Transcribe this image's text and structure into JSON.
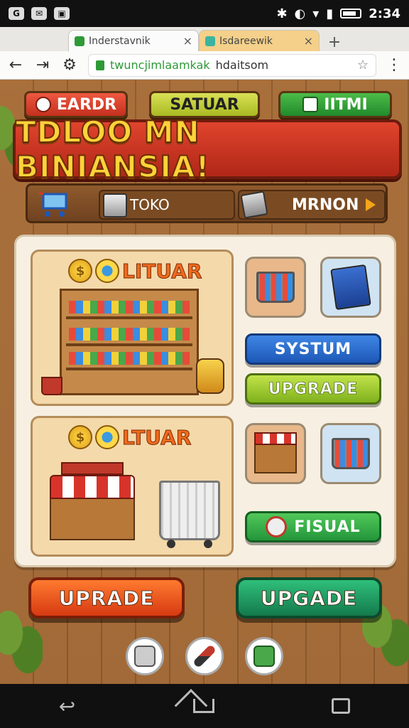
{
  "status_bar": {
    "time": "2:34",
    "left_icons": [
      "messenger-icon",
      "mail-icon",
      "shop-icon"
    ],
    "right_icons": [
      "bluetooth-icon",
      "vibrate-icon",
      "wifi-icon",
      "signal-icon",
      "battery-icon"
    ]
  },
  "browser": {
    "tabs": [
      {
        "label": "Inderstavnik",
        "close": "×",
        "active": true
      },
      {
        "label": "Isdareewik",
        "close": "×",
        "active": false
      }
    ],
    "new_tab": "+",
    "url": {
      "highlight": "twuncjimlaamkak",
      "rest": " hdaitsom"
    },
    "nav": {
      "back": "←",
      "forward": "⇥",
      "settings": "⚙",
      "menu": "⋮",
      "star": "☆"
    }
  },
  "game": {
    "top_chips": [
      {
        "label": "EARDR",
        "color": "#d63a22"
      },
      {
        "label": "SATUAR",
        "color": "#c6d23c"
      },
      {
        "label": "IITMI",
        "color": "#2f9c3a"
      }
    ],
    "title": "TDLOO MN BINIANSIA!",
    "strip": {
      "toko_label": "TOKO",
      "mrnon_label": "MRNON"
    },
    "cards": [
      {
        "coin1": "$",
        "title": "LITUAR"
      },
      {
        "coin1": "$",
        "title": "LTUAR"
      }
    ],
    "buttons": {
      "systum": "SYSTUM",
      "upgrade": "UPGRADE",
      "fisual": "FISUAL",
      "uprade": "UPRADE",
      "upgade": "UPGADE"
    }
  },
  "colors": {
    "accent_red": "#e0442d",
    "title_gold": "#ffd23a",
    "wood": "#a8703c"
  }
}
